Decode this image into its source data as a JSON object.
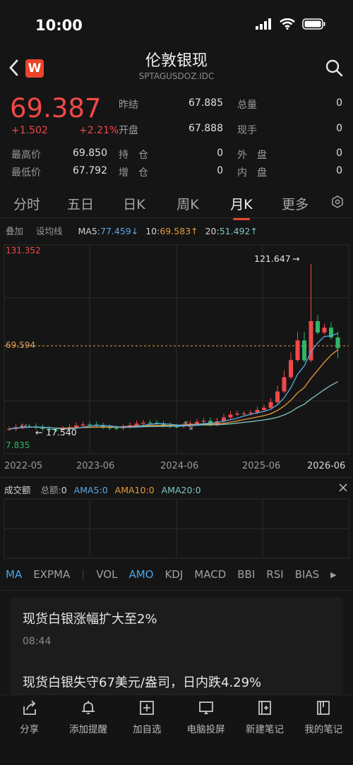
{
  "status_bar": {
    "time": "10:00"
  },
  "header": {
    "title": "伦敦银现",
    "subtitle": "SPTAGUSDOZ.IDC",
    "logo": "W"
  },
  "quote": {
    "price": "69.387",
    "change": "+1.502",
    "change_pct": "+2.21%",
    "stats": [
      {
        "label": "昨结",
        "value": "67.885"
      },
      {
        "label": "总量",
        "value": "0"
      },
      {
        "label": "开盘",
        "value": "67.888"
      },
      {
        "label": "现手",
        "value": "0"
      },
      {
        "label": "最高价",
        "value": "69.850"
      },
      {
        "label": "持　仓",
        "value": "0"
      },
      {
        "label": "外　盘",
        "value": "0"
      },
      {
        "label": "最低价",
        "value": "67.792"
      },
      {
        "label": "增　仓",
        "value": "0"
      },
      {
        "label": "内　盘",
        "value": "0"
      }
    ]
  },
  "tabs": [
    "分时",
    "五日",
    "日K",
    "周K",
    "月K",
    "更多"
  ],
  "active_tab": "月K",
  "ma_bar": {
    "overlay": "叠加",
    "ma_settings": "设均线",
    "ma5_label": "MA5:",
    "ma5": "77.459",
    "ma5_arrow": "↓",
    "ma10_label": "10:",
    "ma10": "69.583",
    "ma10_arrow": "↑",
    "ma20_label": "20:",
    "ma20": "51.492",
    "ma20_arrow": "↑"
  },
  "chart_labels": {
    "y_top": "131.352",
    "y_mid": "69.594",
    "y_bottom": "7.835",
    "high_marker": "121.647",
    "low_marker": "17.540",
    "x_ticks": [
      "2022-05",
      "2023-06",
      "2024-06",
      "2025-06",
      "2026-06"
    ]
  },
  "volume_bar": {
    "title": "成交额",
    "total_label": "总额:",
    "total": "0",
    "ama5_label": "AMA5:",
    "ama5": "0",
    "ama10_label": "AMA10:",
    "ama10": "0",
    "ama20_label": "AMA20:",
    "ama20": "0"
  },
  "indicator_tabs": [
    "MA",
    "EXPMA",
    "VOL",
    "AMO",
    "KDJ",
    "MACD",
    "BBI",
    "RSI",
    "BIAS"
  ],
  "news": [
    {
      "headline": "现货白银涨幅扩大至2%",
      "time": "08:44"
    },
    {
      "headline": "现货白银失守67美元/盎司，日内跌4.29%"
    }
  ],
  "toolbar": [
    "分享",
    "添加提醒",
    "加自选",
    "电脑投屏",
    "新建笔记",
    "我的笔记"
  ],
  "colors": {
    "up": "#f24848",
    "down": "#2fb56a",
    "accent": "#e8452b",
    "ma5": "#5aa8e8",
    "ma10": "#e59a3a",
    "ma20": "#7fc6c6"
  }
}
